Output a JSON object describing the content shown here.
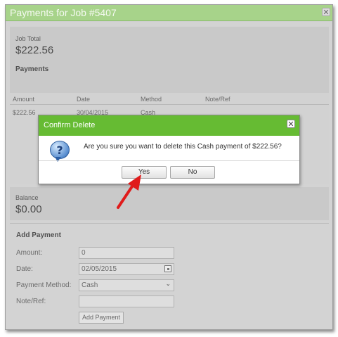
{
  "dialog": {
    "title": "Payments for Job #5407",
    "close_glyph": "✕"
  },
  "summary": {
    "job_total_label": "Job Total",
    "job_total_value": "$222.56",
    "payments_heading": "Payments"
  },
  "payments_table": {
    "columns": [
      "Amount",
      "Date",
      "Method",
      "Note/Ref"
    ],
    "rows": [
      [
        "$222.56",
        "30/04/2015",
        "Cash",
        ""
      ]
    ]
  },
  "balance": {
    "label": "Balance",
    "value": "$0.00"
  },
  "add_payment": {
    "heading": "Add Payment",
    "amount_label": "Amount:",
    "amount_value": "0",
    "date_label": "Date:",
    "date_value": "02/05/2015",
    "method_label": "Payment Method:",
    "method_value": "Cash",
    "note_label": "Note/Ref:",
    "note_value": "",
    "submit_label": "Add Payment"
  },
  "confirm": {
    "title": "Confirm Delete",
    "close_glyph": "✕",
    "icon": "question-icon",
    "message": "Are you sure you want to delete this Cash payment of $222.56?",
    "yes_label": "Yes",
    "no_label": "No"
  },
  "colors": {
    "titlebar_green": "#a7d38a",
    "confirm_green": "#66bb33",
    "arrow_red": "#e01b1b"
  }
}
